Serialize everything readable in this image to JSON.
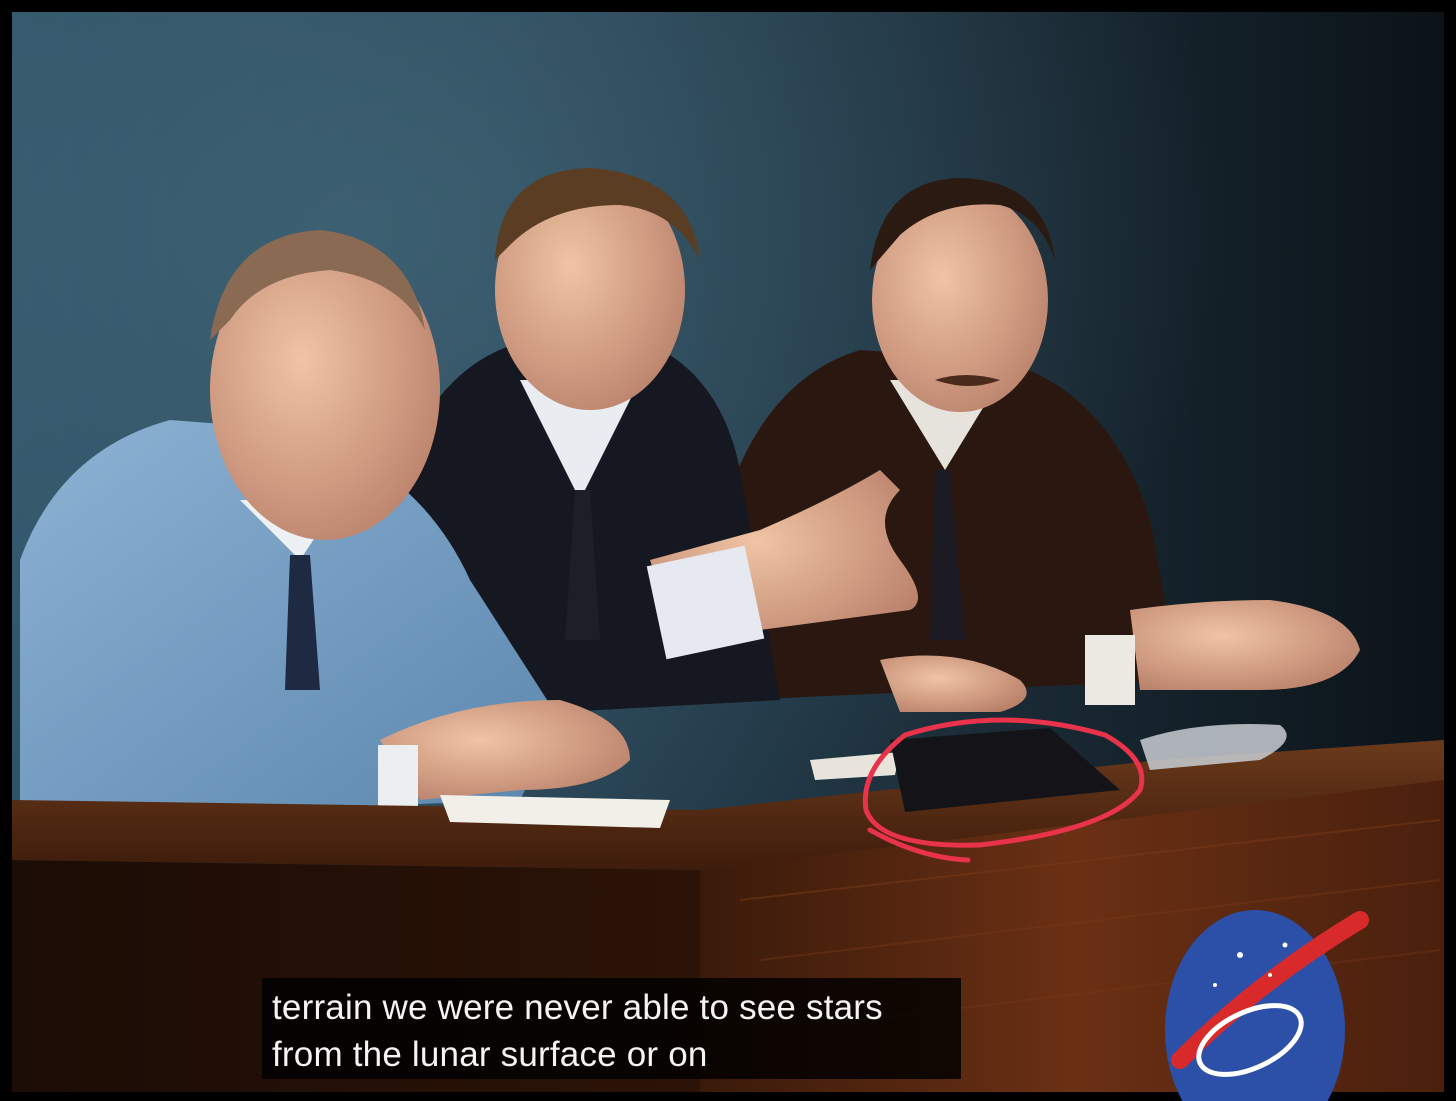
{
  "video": {
    "subtitles": [
      "terrain we were never able to see stars",
      "from the lunar surface or on"
    ],
    "colors": {
      "backdrop": "#2c4a5a",
      "desk": "#5a2a12",
      "annotation": "#e8334a",
      "light_blue_suit": "#7fa6c9",
      "logo_blue": "#2c4fa8"
    }
  }
}
